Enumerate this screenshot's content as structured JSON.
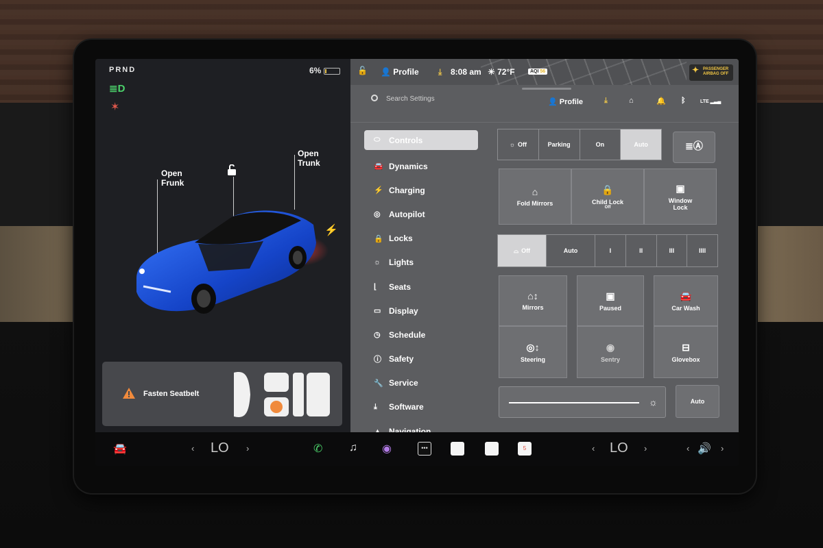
{
  "left_panel": {
    "gear": "PRND",
    "battery_percent": "6%",
    "frunk_label": "Open\nFrunk",
    "trunk_label": "Open\nTrunk",
    "alert": {
      "text": "Fasten Seatbelt"
    }
  },
  "status_bar": {
    "profile": "Profile",
    "time": "8:08 am",
    "temperature": "72°F",
    "aqi_label": "AQI",
    "aqi_value": "56",
    "airbag_line1": "PASSENGER",
    "airbag_line2": "AIRBAG OFF"
  },
  "settings_header": {
    "search_placeholder": "Search Settings",
    "profile": "Profile",
    "network": "LTE"
  },
  "menu": [
    {
      "icon": "toggle-icon",
      "glyph": "⬭",
      "label": "Controls",
      "active": true
    },
    {
      "icon": "car-icon",
      "glyph": "🚘",
      "label": "Dynamics"
    },
    {
      "icon": "bolt-icon",
      "glyph": "⚡",
      "label": "Charging"
    },
    {
      "icon": "steering-icon",
      "glyph": "◎",
      "label": "Autopilot"
    },
    {
      "icon": "lock-icon",
      "glyph": "🔒",
      "label": "Locks"
    },
    {
      "icon": "light-icon",
      "glyph": "☼",
      "label": "Lights"
    },
    {
      "icon": "seat-icon",
      "glyph": "⌊",
      "label": "Seats"
    },
    {
      "icon": "display-icon",
      "glyph": "▭",
      "label": "Display"
    },
    {
      "icon": "clock-icon",
      "glyph": "◷",
      "label": "Schedule"
    },
    {
      "icon": "safety-icon",
      "glyph": "ⓘ",
      "label": "Safety"
    },
    {
      "icon": "wrench-icon",
      "glyph": "🔧",
      "label": "Service"
    },
    {
      "icon": "download-icon",
      "glyph": "⤓",
      "label": "Software"
    },
    {
      "icon": "navigation-icon",
      "glyph": "▲",
      "label": "Navigation"
    }
  ],
  "controls": {
    "lights": [
      "Off",
      "Parking",
      "On",
      "Auto"
    ],
    "lights_selected": "Auto",
    "fold_mirrors": "Fold Mirrors",
    "child_lock": "Child Lock",
    "child_lock_state": "Off",
    "window_lock": "Window\nLock",
    "wipers": [
      "Off",
      "Auto",
      "I",
      "II",
      "III",
      "IIII"
    ],
    "wipers_selected": "Off",
    "mirrors": "Mirrors",
    "dashcam": "Paused",
    "car_wash": "Car Wash",
    "steering": "Steering",
    "sentry": "Sentry",
    "glovebox": "Glovebox",
    "brightness_auto": "Auto"
  },
  "taskbar": {
    "left_temp": "LO",
    "right_temp": "LO",
    "calendar_day": "5"
  }
}
